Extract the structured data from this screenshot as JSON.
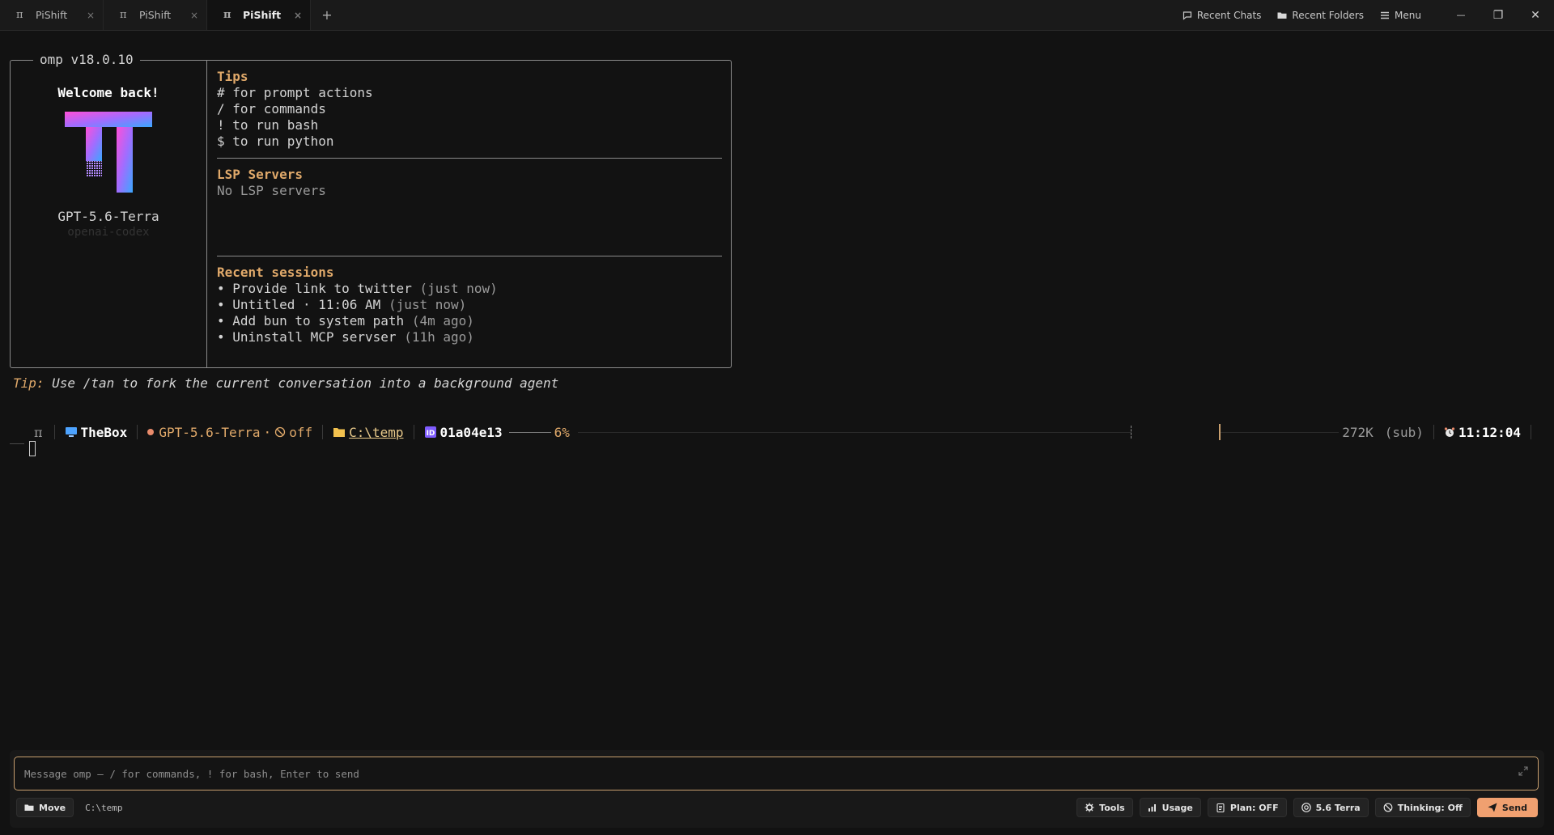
{
  "tabs": [
    {
      "icon": "pi-icon",
      "label": "PiShift",
      "active": false
    },
    {
      "icon": "pi-icon",
      "label": "PiShift",
      "active": false
    },
    {
      "icon": "pi-icon",
      "label": "PiShift",
      "active": true
    }
  ],
  "tab_close": "×",
  "tab_add": "+",
  "pi_glyph": "π",
  "titlebar": {
    "recent_chats": "Recent Chats",
    "recent_folders": "Recent Folders",
    "menu": "Menu",
    "minimize": "—",
    "restore": "❐",
    "close": "✕"
  },
  "welcome": {
    "version": "omp v18.0.10",
    "greeting": "Welcome back!",
    "model": "GPT-5.6-Terra",
    "provider": "openai-codex",
    "logo_gradient": [
      "#ff4fd8",
      "#a26cff",
      "#3aa8ff"
    ]
  },
  "tips": {
    "title": "Tips",
    "items": [
      "# for prompt actions",
      "/ for commands",
      "! to run bash",
      "$ to run python"
    ]
  },
  "lsp": {
    "title": "LSP Servers",
    "status": "No LSP servers"
  },
  "recent_sessions": {
    "title": "Recent sessions",
    "items": [
      {
        "name": "• Provide link to twitter",
        "age": "(just now)"
      },
      {
        "name": "• Untitled · 11:06 AM",
        "age": "(just now)"
      },
      {
        "name": "• Add bun to system path",
        "age": "(4m ago)"
      },
      {
        "name": "• Uninstall MCP servser",
        "age": "(11h ago)"
      }
    ]
  },
  "tip": {
    "label": "Tip:",
    "text": " Use /tan to fork the current conversation into a background agent"
  },
  "status": {
    "host": "TheBox",
    "model": "GPT-5.6-Terra",
    "mid_dot": "·",
    "thinking": "off",
    "path": "C:\\temp",
    "session_id": "01a04e13",
    "context_pct": "6%",
    "context_fill": 0.06,
    "tokens": "272K",
    "plan": "(sub)",
    "clock": "11:12:04"
  },
  "composer": {
    "placeholder": "Message omp — / for commands, ! for bash, Enter to send",
    "value": ""
  },
  "toolbar": {
    "move": "Move",
    "path": "C:\\temp",
    "tools": "Tools",
    "usage": "Usage",
    "plan": "Plan: OFF",
    "model": "5.6 Terra",
    "thinking": "Thinking: Off",
    "send": "Send"
  },
  "colors": {
    "accent": "#e0a96a",
    "send": "#f0a070",
    "background": "#121212"
  }
}
